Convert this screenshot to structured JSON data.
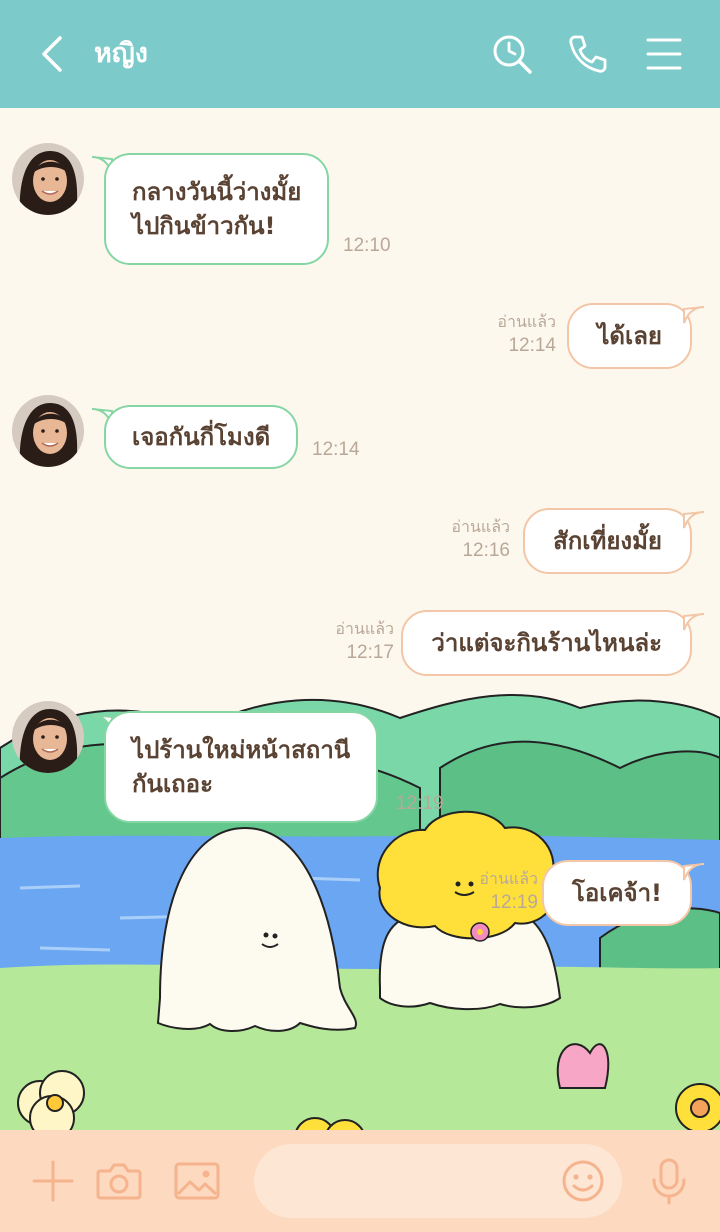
{
  "header": {
    "title": "หญิง",
    "icons": [
      "back-icon",
      "search-history-icon",
      "phone-icon",
      "menu-icon"
    ]
  },
  "messages": [
    {
      "side": "in",
      "lines": [
        "กลางวันนี้ว่างมั้ย",
        "ไปกินข้าวกัน!"
      ],
      "time": "12:10"
    },
    {
      "side": "out",
      "text": "ได้เลย",
      "read": "อ่านแล้ว",
      "time": "12:14"
    },
    {
      "side": "in",
      "text": "เจอกันกี่โมงดี",
      "time": "12:14"
    },
    {
      "side": "out",
      "text": "สักเที่ยงมั้ย",
      "read": "อ่านแล้ว",
      "time": "12:16"
    },
    {
      "side": "out",
      "text": "ว่าแต่จะกินร้านไหนล่ะ",
      "read": "อ่านแล้ว",
      "time": "12:17"
    },
    {
      "side": "in",
      "lines": [
        "ไปร้านใหม่หน้าสถานี",
        "กันเถอะ"
      ],
      "time": "12:19"
    },
    {
      "side": "out",
      "text": "โอเคจ้า!",
      "read": "อ่านแล้ว",
      "time": "12:19"
    }
  ],
  "composer": {
    "placeholder": "",
    "icons": [
      "plus-icon",
      "camera-icon",
      "image-icon",
      "emoji-icon",
      "microphone-icon"
    ]
  },
  "colors": {
    "header": "#7dcaca",
    "chat_background": "#fdf8ee",
    "incoming_border": "#86d6a4",
    "outgoing_border": "#f2c6a6",
    "bottom_bar": "#fcd9bf",
    "text": "#5b4334"
  }
}
